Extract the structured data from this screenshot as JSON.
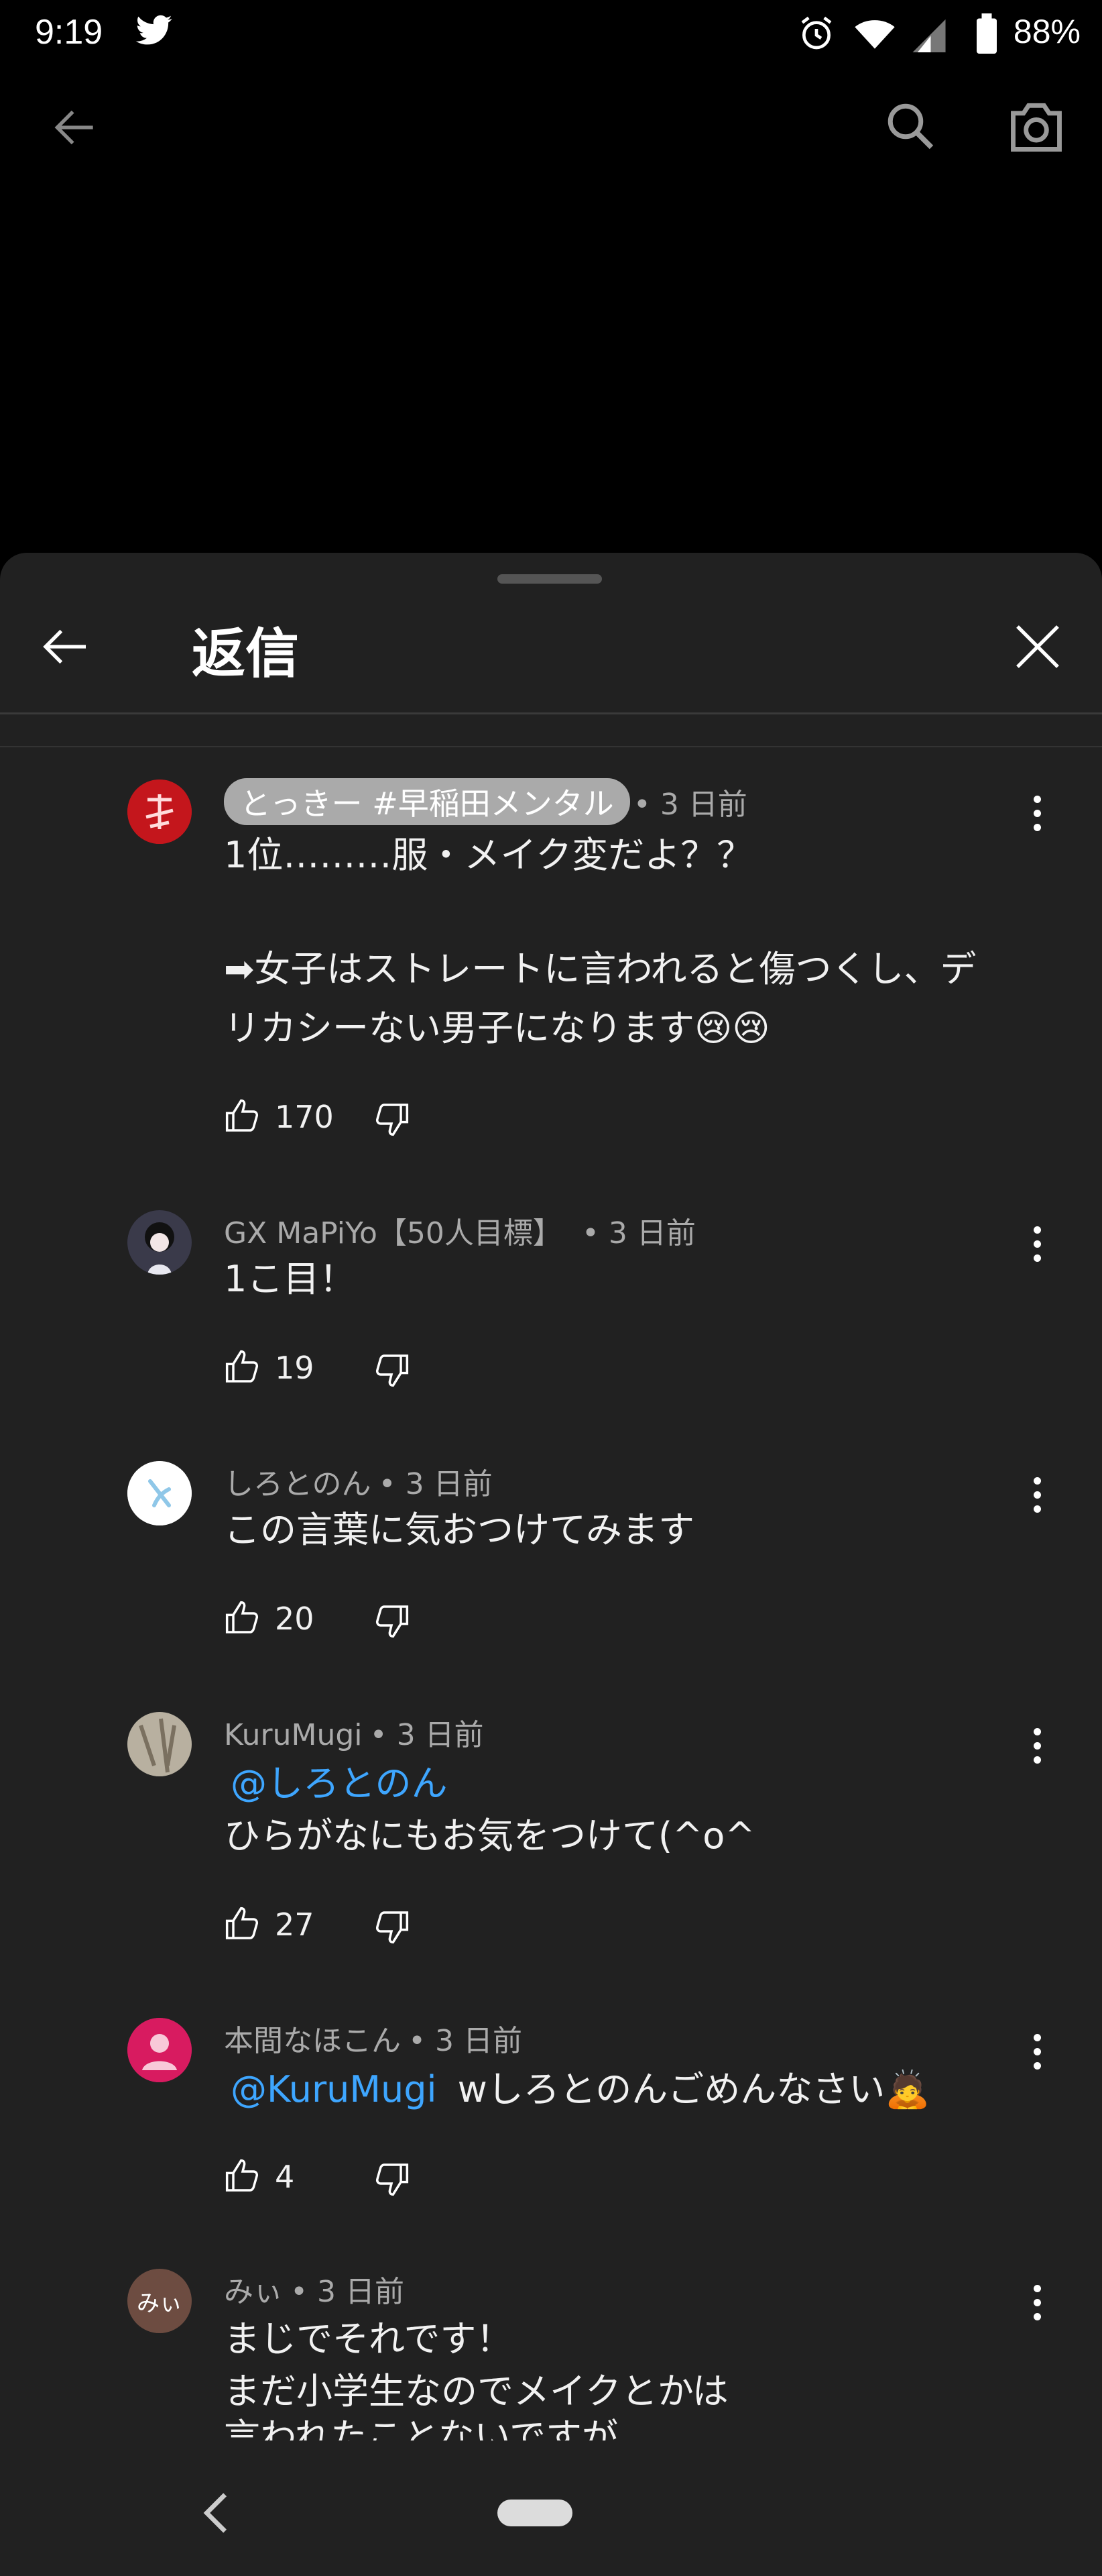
{
  "status_bar": {
    "time": "9:19",
    "battery": "88%",
    "icons": [
      "twitter-icon",
      "alarm-icon",
      "wifi-icon",
      "signal-icon",
      "battery-icon"
    ]
  },
  "top_bar": {
    "icons": [
      "back-arrow-icon",
      "search-icon",
      "camera-icon"
    ]
  },
  "sheet": {
    "title": "返信",
    "icons": [
      "back-arrow-icon",
      "close-icon"
    ]
  },
  "comments": [
    {
      "author": "とっきー #早稲田メンタル",
      "time": "• 3 日前",
      "lines": [
        "1位………服・メイク変だよ？？",
        "",
        "➡女子はストレートに言われると傷つくし、デ",
        "リカシーない男子になります😢😢"
      ],
      "likes": "170",
      "avatar_color": "#c4161c"
    },
    {
      "author": "GX MaPiYo【50人目標】",
      "time": "• 3 日前",
      "lines": [
        "1こ目！"
      ],
      "likes": "19",
      "avatar_color": "#2b2b3a"
    },
    {
      "author": "しろとのん",
      "time": "• 3 日前",
      "lines": [
        "この言葉に気おつけてみます"
      ],
      "likes": "20",
      "avatar_color": "#ffffff"
    },
    {
      "author": "KuruMugi",
      "time": "• 3 日前",
      "mention": "@しろとのん",
      "lines": [
        "ひらがなにもお気をつけて(^o^"
      ],
      "likes": "27",
      "avatar_color": "#8a8a80"
    },
    {
      "author": "本間なほこん",
      "time": "• 3 日前",
      "mention": "@KuruMugi",
      "inline_text": "wしろとのんごめんなさい🙇",
      "likes": "4",
      "avatar_color": "#d81b60"
    },
    {
      "author": "みぃ",
      "time": "• 3 日前",
      "avatar_label": "みぃ",
      "lines": [
        "まじでそれです！",
        "まだ小学生なのでメイクとかは",
        "言われたことないですが"
      ],
      "avatar_color": "#6d4c41"
    }
  ],
  "nav_bar": {
    "icons": [
      "nav-back-icon",
      "home-pill"
    ]
  }
}
